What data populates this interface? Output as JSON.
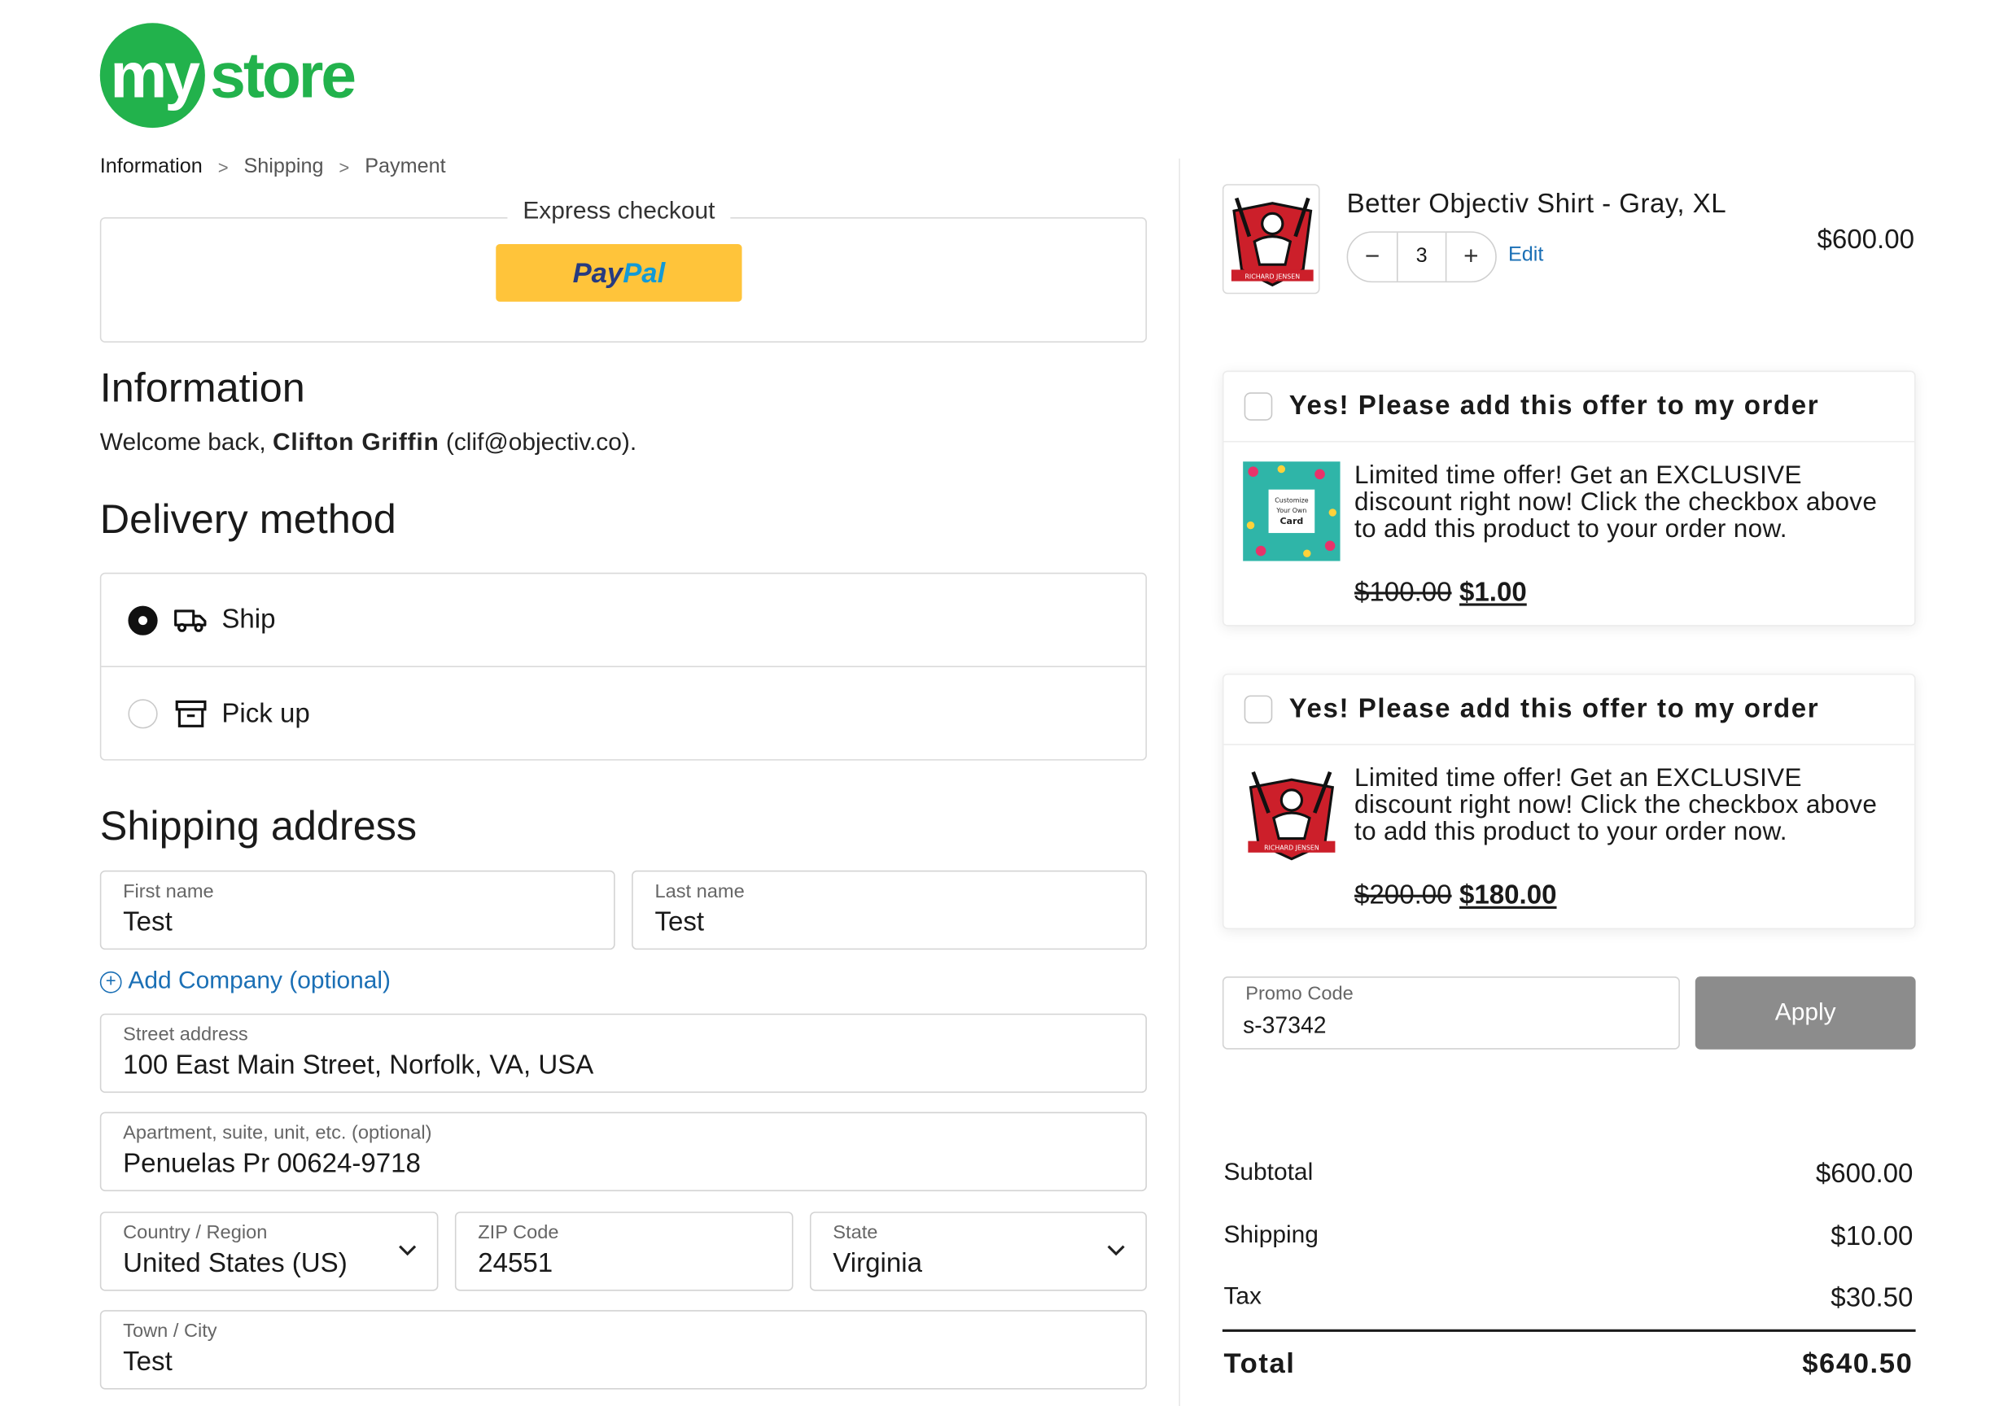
{
  "brand": {
    "logo_my": "my",
    "logo_store": "store",
    "green": "#22b24c"
  },
  "breadcrumb": {
    "step1": "Information",
    "step2": "Shipping",
    "step3": "Payment",
    "sep": ">"
  },
  "express": {
    "title": "Express checkout",
    "paypal_a": "Pay",
    "paypal_b": "Pal"
  },
  "information": {
    "heading": "Information",
    "welcome_prefix": "Welcome back, ",
    "name": "Clifton Griffin",
    "email": "(clif@objectiv.co)."
  },
  "delivery": {
    "heading": "Delivery method",
    "options": [
      {
        "label": "Ship",
        "icon": "truck-icon",
        "selected": true
      },
      {
        "label": "Pick up",
        "icon": "archive-box-icon",
        "selected": false
      }
    ]
  },
  "shipping": {
    "heading": "Shipping address",
    "first_name": {
      "label": "First name",
      "value": "Test"
    },
    "last_name": {
      "label": "Last name",
      "value": "Test"
    },
    "add_company": "Add Company (optional)",
    "street": {
      "label": "Street address",
      "value": "100 East Main Street, Norfolk, VA, USA"
    },
    "apartment": {
      "label": "Apartment, suite, unit, etc. (optional)",
      "value": "Penuelas Pr 00624-9718"
    },
    "country": {
      "label": "Country / Region",
      "value": "United States (US)"
    },
    "zip": {
      "label": "ZIP Code",
      "value": "24551"
    },
    "state": {
      "label": "State",
      "value": "Virginia"
    },
    "city": {
      "label": "Town / City",
      "value": "Test"
    }
  },
  "cart": {
    "item": {
      "title": "Better Objectiv Shirt - Gray, XL",
      "qty": "3",
      "minus": "−",
      "plus": "+",
      "edit": "Edit",
      "price": "$600.00",
      "thumb_caption": "RICHARD JENSEN"
    },
    "offers": [
      {
        "title": "Yes! Please add this offer to my order",
        "desc": "Limited time offer! Get an EXCLUSIVE discount right now! Click the checkbox above to add this product to your order now.",
        "old_price": "$100.00",
        "new_price": "$1.00",
        "image_caption": [
          "Customize",
          "Your Own",
          "Card"
        ]
      },
      {
        "title": "Yes! Please add this offer to my order",
        "desc": "Limited time offer! Get an EXCLUSIVE discount right now! Click the checkbox above to add this product to your order now.",
        "old_price": "$200.00",
        "new_price": "$180.00",
        "image_caption": "RICHARD JENSEN"
      }
    ],
    "promo": {
      "label": "Promo Code",
      "value": "s-37342",
      "apply": "Apply"
    },
    "summary": {
      "subtotal_label": "Subtotal",
      "subtotal": "$600.00",
      "shipping_label": "Shipping",
      "shipping": "$10.00",
      "tax_label": "Tax",
      "tax": "$30.50",
      "total_label": "Total",
      "total": "$640.50"
    }
  },
  "colors": {
    "link": "#1a6fb5",
    "paypal_yellow": "#ffc43a",
    "apply_gray": "#8c8c8c"
  }
}
